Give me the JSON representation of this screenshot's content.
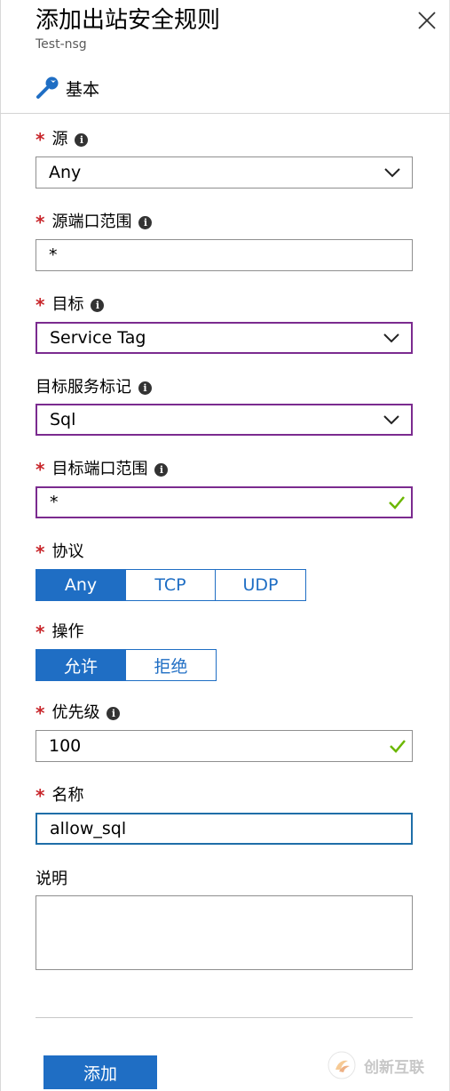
{
  "header": {
    "title": "添加出站安全规则",
    "subtitle": "Test-nsg",
    "section_tab": "基本"
  },
  "form": {
    "required_mark": "*",
    "source": {
      "label": "源",
      "value": "Any"
    },
    "source_port_range": {
      "label": "源端口范围",
      "value": "*"
    },
    "destination": {
      "label": "目标",
      "value": "Service Tag"
    },
    "destination_service_tag": {
      "label": "目标服务标记",
      "value": "Sql"
    },
    "destination_port_range": {
      "label": "目标端口范围",
      "value": "*"
    },
    "protocol": {
      "label": "协议",
      "options": [
        "Any",
        "TCP",
        "UDP"
      ],
      "selected": "Any"
    },
    "action": {
      "label": "操作",
      "options": [
        "允许",
        "拒绝"
      ],
      "selected": "允许"
    },
    "priority": {
      "label": "优先级",
      "value": "100"
    },
    "name": {
      "label": "名称",
      "value": "allow_sql"
    },
    "description": {
      "label": "说明",
      "value": ""
    }
  },
  "footer": {
    "add_label": "添加"
  },
  "watermark": {
    "text": "创新互联"
  },
  "colors": {
    "accent": "#1f6ec4",
    "required": "#c8262b",
    "focus_purple": "#7b2b8f",
    "valid_green": "#6bb700"
  },
  "icons": {
    "close": "close-icon",
    "wrench": "wrench-icon",
    "info": "info-icon",
    "chevron": "chevron-down-icon",
    "check": "checkmark-icon"
  }
}
